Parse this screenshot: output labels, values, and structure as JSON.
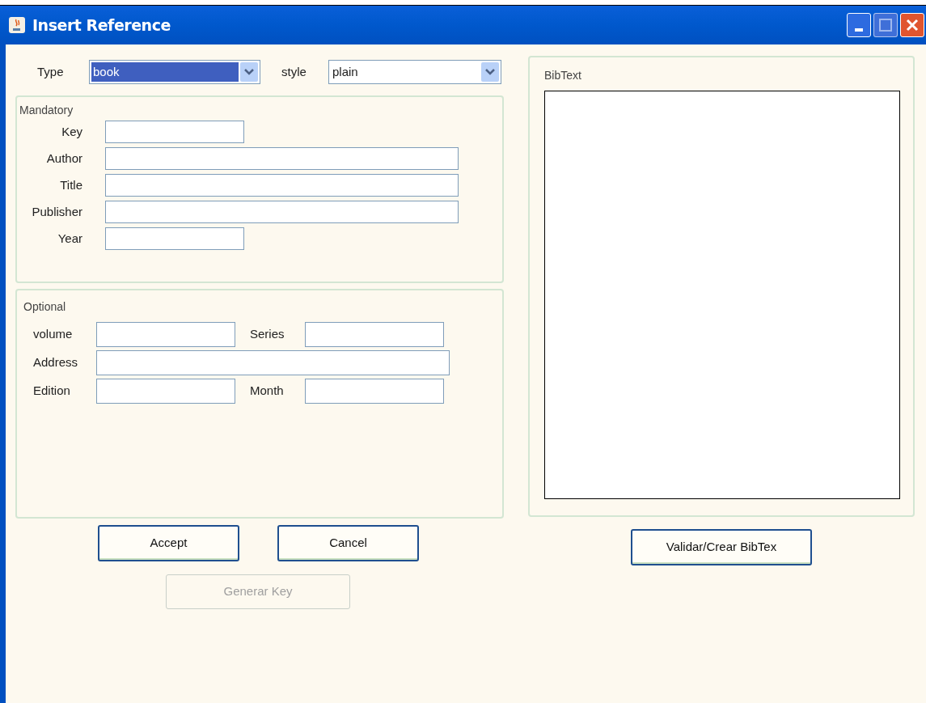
{
  "window": {
    "title": "Insert Reference"
  },
  "type_field": {
    "label": "Type",
    "value": "book",
    "selected": true
  },
  "style_field": {
    "label": "style",
    "value": "plain",
    "selected": false
  },
  "mandatory": {
    "title": "Mandatory",
    "fields": [
      {
        "label": "Key",
        "kind": "short"
      },
      {
        "label": "Author",
        "kind": "long"
      },
      {
        "label": "Title",
        "kind": "long"
      },
      {
        "label": "Publisher",
        "kind": "long"
      },
      {
        "label": "Year",
        "kind": "short"
      }
    ]
  },
  "optional": {
    "title": "Optional",
    "rows": [
      [
        {
          "label": "volume",
          "kind": "short"
        },
        {
          "label": "Series",
          "kind": "short"
        }
      ],
      [
        {
          "label": "Address",
          "kind": "long"
        }
      ],
      [
        {
          "label": "Edition",
          "kind": "short"
        },
        {
          "label": "Month",
          "kind": "short"
        }
      ]
    ]
  },
  "bibtext": {
    "title": "BibText"
  },
  "buttons": [
    {
      "label": "Accept",
      "disabled": false
    },
    {
      "label": "Cancel",
      "disabled": false
    }
  ],
  "generate_button": {
    "label": "Generar Key",
    "disabled": true
  },
  "validate_button": {
    "label": "Validar/Crear BibTex",
    "disabled": false
  }
}
